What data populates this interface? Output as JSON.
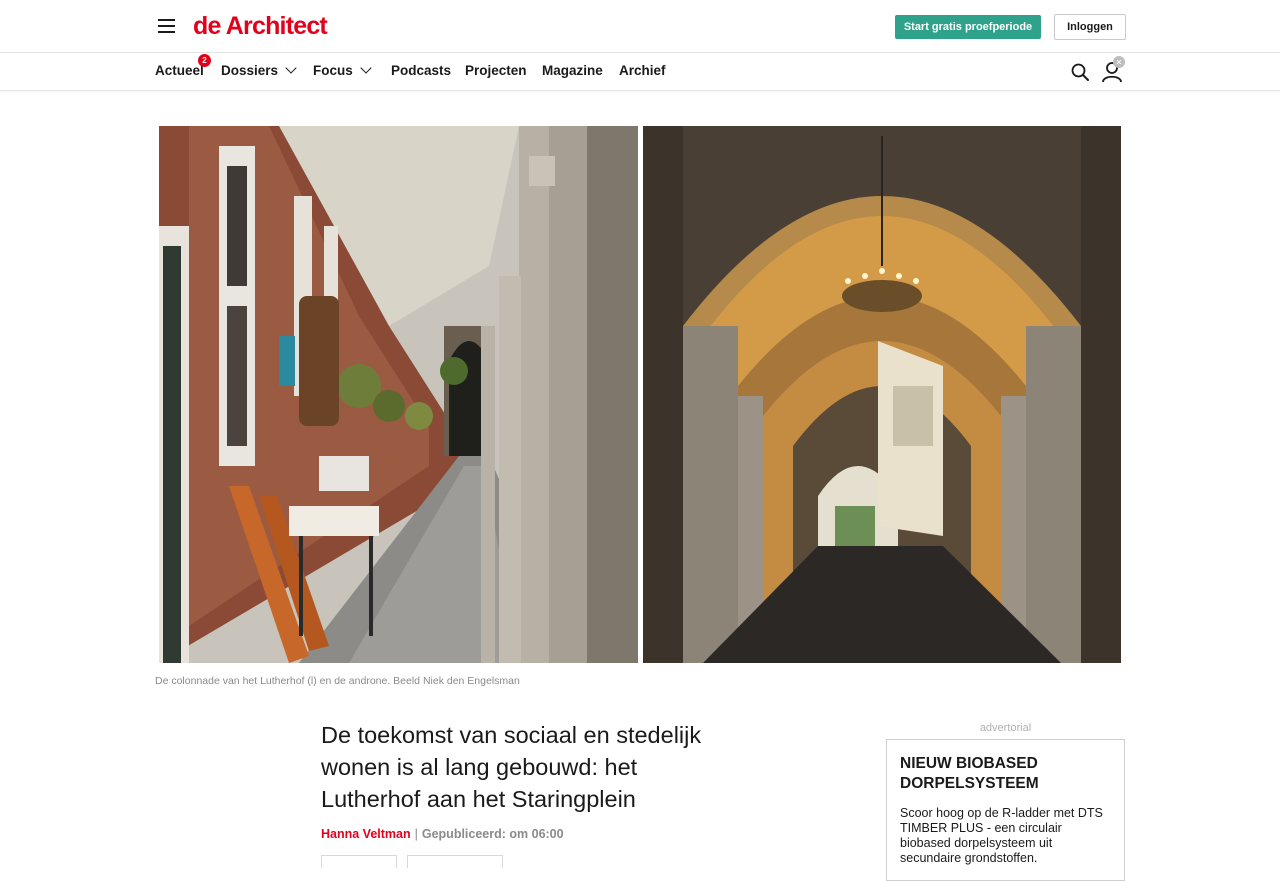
{
  "header": {
    "logo": "de Architect",
    "trial_button": "Start gratis proefperiode",
    "login_button": "Inloggen"
  },
  "nav": {
    "items": [
      {
        "label": "Actueel"
      },
      {
        "label": "Dossiers"
      },
      {
        "label": "Focus"
      },
      {
        "label": "Podcasts"
      },
      {
        "label": "Projecten"
      },
      {
        "label": "Magazine"
      },
      {
        "label": "Archief"
      }
    ],
    "actueel_badge": "2"
  },
  "hero": {
    "caption": "De colonnade van het Lutherhof (l) en de androne. Beeld Niek den Engelsman"
  },
  "article": {
    "title": "De toekomst van sociaal en stedelijk wonen is al lang gebouwd: het Lutherhof aan het Staringplein",
    "author": "Hanna Veltman",
    "separator": "|",
    "published": "Gepubliceerd: om 06:00"
  },
  "advertorial": {
    "label": "advertorial",
    "title": "NIEUW BIOBASED DORPELSYSTEEM",
    "text": "Scoor hoog op de R-ladder met DTS TIMBER PLUS - een circulair biobased dorpelsysteem uit secundaire grondstoffen."
  },
  "colors": {
    "brand_red": "#e3001b",
    "accent_green": "#2fa28c"
  },
  "icons": [
    "menu-icon",
    "chevron-down-icon",
    "search-icon",
    "user-icon",
    "close-icon"
  ]
}
